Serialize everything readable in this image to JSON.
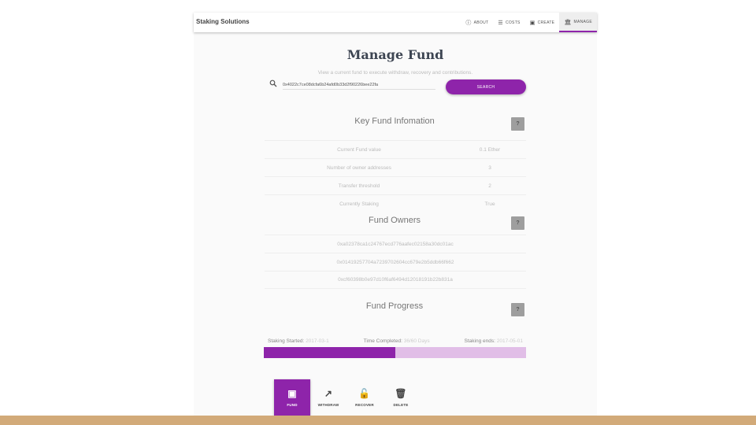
{
  "app": {
    "brand": "Staking Solutions"
  },
  "nav": [
    {
      "label": "ABOUT",
      "icon": "info-icon"
    },
    {
      "label": "COSTS",
      "icon": "list-icon"
    },
    {
      "label": "CREATE",
      "icon": "wallet-icon"
    },
    {
      "label": "MANAGE",
      "icon": "bank-icon",
      "active": true
    }
  ],
  "page": {
    "title": "Manage Fund",
    "subtitle": "View a current fund to execute withdraw, recovery and contributions."
  },
  "search": {
    "value": "0x4022c7ce08dcfa6b24afd0b33d2f90226bee22fa",
    "button_label": "SEARCH"
  },
  "key_info": {
    "title": "Key Fund Infomation",
    "help": "?",
    "rows": [
      {
        "label": "Current Fund value",
        "value": "0.1 Ether"
      },
      {
        "label": "Number of owner addresses",
        "value": "3"
      },
      {
        "label": "Transfer threshold",
        "value": "2"
      },
      {
        "label": "Currently Staking",
        "value": "True"
      }
    ]
  },
  "owners": {
    "title": "Fund Owners",
    "help": "?",
    "addresses": [
      "0xa02378ca1c24767ecd776aafec02158a30dc01ac",
      "0x01419257704a7239702604cc679e2b5ddb66f662",
      "0xcf60398b0e97d10f6af6494d12018191b22b831a"
    ]
  },
  "progress": {
    "title": "Fund Progress",
    "help": "?",
    "started_label": "Staking Started:",
    "started_value": "2017-03-1",
    "completed_label": "Time Completed:",
    "completed_value": "36/60 Days",
    "ends_label": "Staking ends:",
    "ends_value": "2017-05-01",
    "fraction": 0.5
  },
  "actions": [
    {
      "label": "FUND",
      "icon": "wallet-icon",
      "active": true
    },
    {
      "label": "WITHDRAW",
      "icon": "arrow-up-right-icon"
    },
    {
      "label": "RECOVER",
      "icon": "lock-icon"
    },
    {
      "label": "DELETE",
      "icon": "trash-icon"
    }
  ],
  "colors": {
    "accent": "#8e24aa",
    "accent_light": "#e1bee7",
    "footer": "#d2aa79"
  }
}
